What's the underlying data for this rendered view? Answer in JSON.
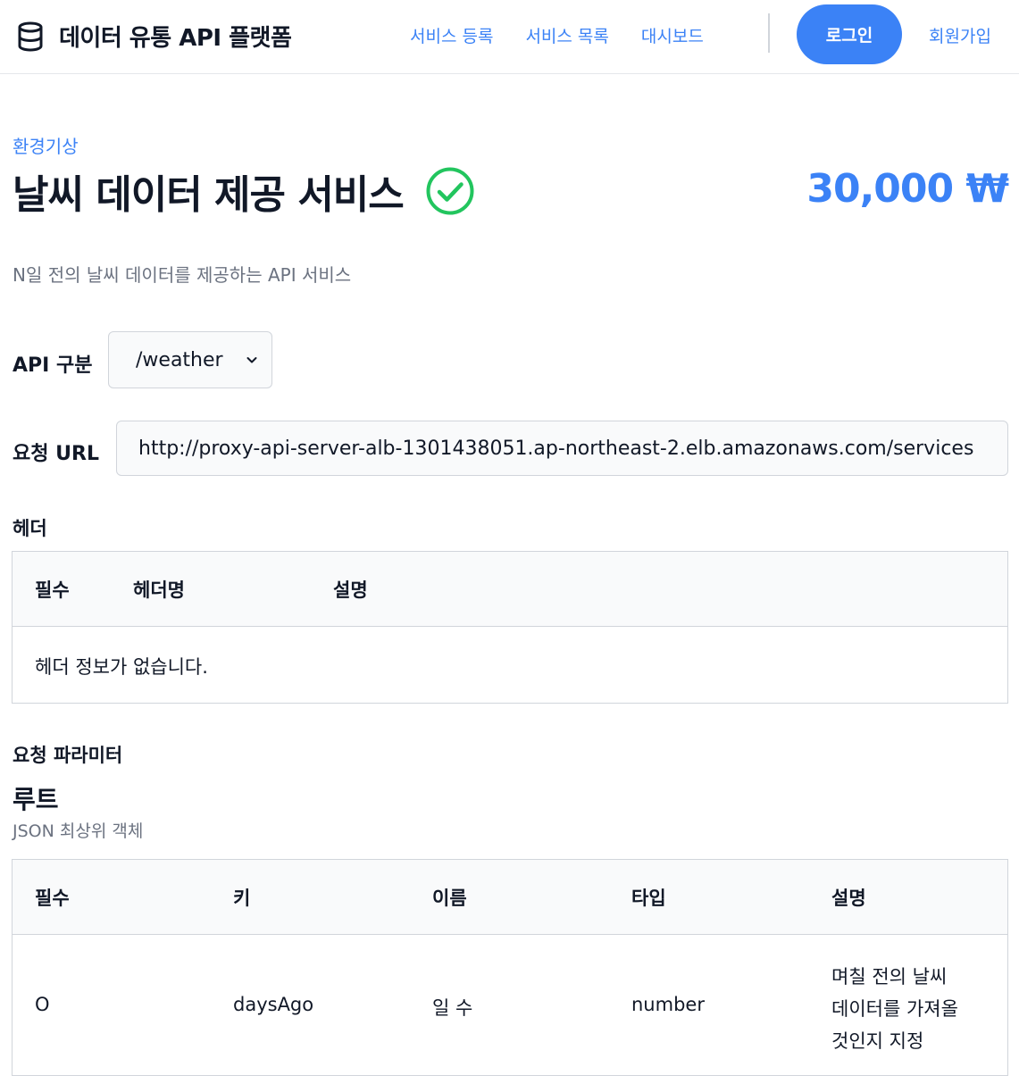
{
  "header": {
    "brand_icon": "database-icon",
    "brand_title": "데이터 유통 API 플랫폼",
    "nav": [
      {
        "label": "서비스 등록"
      },
      {
        "label": "서비스 목록"
      },
      {
        "label": "대시보드"
      }
    ],
    "login_label": "로그인",
    "signup_label": "회원가입",
    "accent_color": "#3b82f6"
  },
  "service": {
    "category": "환경기상",
    "title": "날씨 데이터 제공 서비스",
    "verified_icon": "check-circle-icon",
    "verified_color": "#22c55e",
    "price": "30,000 ₩",
    "description": "N일 전의 날씨 데이터를 제공하는 API 서비스"
  },
  "api_section": {
    "label": "API 구분",
    "selected_value": "/weather",
    "dropdown_icon": "chevron-down-icon"
  },
  "url_section": {
    "label": "요청 URL",
    "value": "http://proxy-api-server-alb-1301438051.ap-northeast-2.elb.amazonaws.com/services"
  },
  "headers_section": {
    "label": "헤더",
    "columns": [
      "필수",
      "헤더명",
      "설명"
    ],
    "empty_message": "헤더 정보가 없습니다."
  },
  "params_section": {
    "label": "요청 파라미터",
    "root_title": "루트",
    "root_subtitle": "JSON 최상위 객체",
    "columns": [
      "필수",
      "키",
      "이름",
      "타입",
      "설명"
    ],
    "rows": [
      {
        "required": "O",
        "key": "daysAgo",
        "name": "일 수",
        "type": "number",
        "description_lines": [
          "며칠 전의 날씨",
          "데이터를 가져올",
          "것인지 지정"
        ]
      }
    ]
  }
}
